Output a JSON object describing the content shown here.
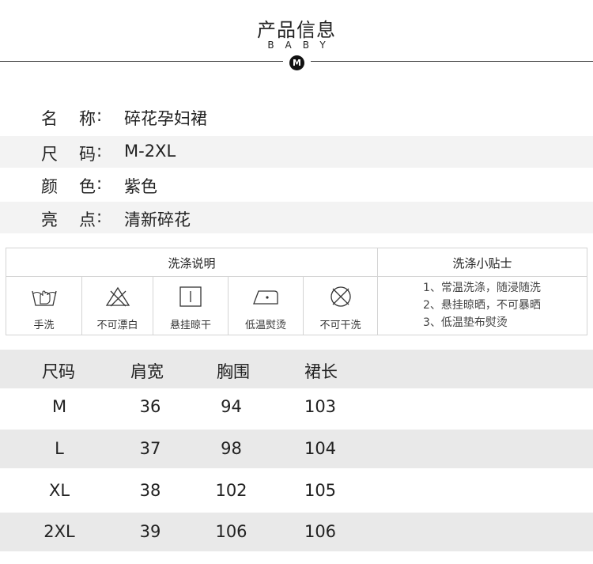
{
  "header": {
    "title": "产品信息",
    "subtitle": "BABY",
    "badge": "M"
  },
  "info": [
    {
      "k1": "名",
      "k2": "称",
      "value": "碎花孕妇裙"
    },
    {
      "k1": "尺",
      "k2": "码",
      "value": "M-2XL"
    },
    {
      "k1": "颜",
      "k2": "色",
      "value": "紫色"
    },
    {
      "k1": "亮",
      "k2": "点",
      "value": "清新碎花"
    }
  ],
  "colon": ":",
  "care": {
    "instructions_title": "洗涤说明",
    "tips_title": "洗涤小贴士",
    "icons": [
      {
        "icon": "hand-wash-icon",
        "label": "手洗"
      },
      {
        "icon": "no-bleach-icon",
        "label": "不可漂白"
      },
      {
        "icon": "hang-dry-icon",
        "label": "悬挂晾干"
      },
      {
        "icon": "low-iron-icon",
        "label": "低温熨烫"
      },
      {
        "icon": "no-dry-clean-icon",
        "label": "不可干洗"
      }
    ],
    "tips": [
      "1、常温洗涤，随浸随洗",
      "2、悬挂晾晒，不可暴晒",
      "3、低温垫布熨烫"
    ]
  },
  "size_table": {
    "headers": [
      "尺码",
      "肩宽",
      "胸围",
      "裙长"
    ],
    "rows": [
      [
        "M",
        "36",
        "94",
        "103"
      ],
      [
        "L",
        "37",
        "98",
        "104"
      ],
      [
        "XL",
        "38",
        "102",
        "105"
      ],
      [
        "2XL",
        "39",
        "106",
        "106"
      ]
    ]
  }
}
